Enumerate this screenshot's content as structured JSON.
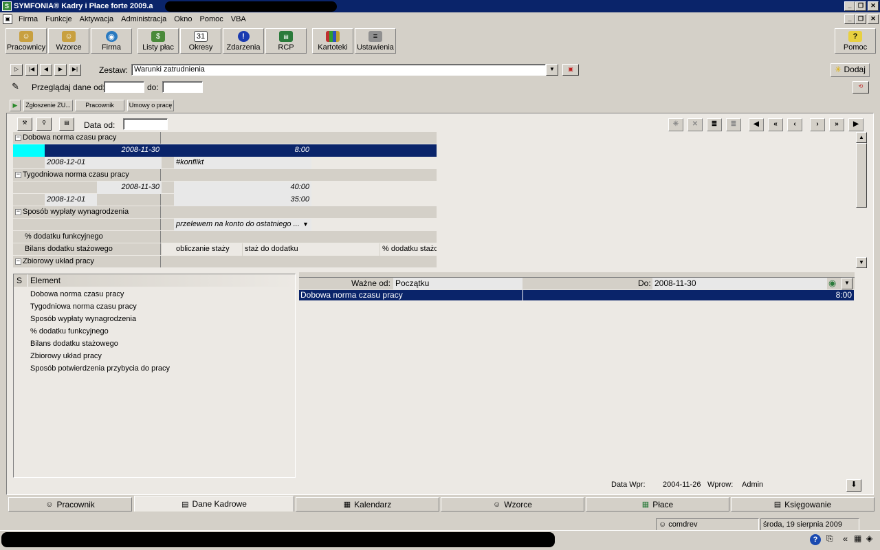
{
  "window": {
    "title": "SYMFONIA® Kadry i Płace forte 2009.a"
  },
  "menu": [
    "Firma",
    "Funkcje",
    "Aktywacja",
    "Administracja",
    "Okno",
    "Pomoc",
    "VBA"
  ],
  "toolbar": {
    "buttons": [
      {
        "label": "Pracownicy",
        "icon": "people-icon"
      },
      {
        "label": "Wzorce",
        "icon": "templates-icon"
      },
      {
        "label": "Firma",
        "icon": "globe-icon"
      },
      {
        "label": "Listy płac",
        "icon": "money-icon"
      },
      {
        "label": "Okresy",
        "icon": "calendar-icon"
      },
      {
        "label": "Zdarzenia",
        "icon": "exclamation-icon"
      },
      {
        "label": "RCP",
        "icon": "rcp-icon"
      },
      {
        "label": "Kartoteki",
        "icon": "binders-icon"
      },
      {
        "label": "Ustawienia",
        "icon": "sliders-icon"
      }
    ],
    "help": "Pomoc"
  },
  "filter": {
    "zestaw_label": "Zestaw:",
    "zestaw_value": "Warunki zatrudnienia",
    "add_label": "Dodaj",
    "browse_label": "Przeglądaj dane od:",
    "to_label": "do:",
    "from_value": "",
    "to_value": ""
  },
  "subtabs": [
    "Zgłoszenie ZU...",
    "Pracownik",
    "Umowy o pracę"
  ],
  "grid": {
    "date_label": "Data od:",
    "date_value": "",
    "rows": [
      {
        "type": "group",
        "label": "Dobowa norma czasu pracy"
      },
      {
        "type": "child",
        "date": "2008-11-30",
        "value": "8:00",
        "selected": true
      },
      {
        "type": "child2",
        "date": "2008-12-01",
        "value": "#konflikt"
      },
      {
        "type": "group",
        "label": "Tygodniowa norma czasu pracy"
      },
      {
        "type": "child",
        "date": "2008-11-30",
        "value": "40:00"
      },
      {
        "type": "child2",
        "date": "2008-12-01",
        "value": "35:00"
      },
      {
        "type": "group",
        "label": "Sposób wypłaty wynagrodzenia"
      },
      {
        "type": "combo",
        "value": "przelewem na konto do ostatniego ..."
      },
      {
        "type": "plain",
        "label": "% dodatku funkcyjnego"
      },
      {
        "type": "triple",
        "label": "Bilans dodatku stażowego",
        "c1": "obliczanie staży",
        "c2": "staż do dodatku",
        "c3": "% dodatku stażo..."
      },
      {
        "type": "group",
        "label": "Zbiorowy układ pracy"
      }
    ]
  },
  "elements": {
    "col_s": "S",
    "col_element": "Element",
    "items": [
      "Dobowa norma czasu pracy",
      "Tygodniowa norma czasu pracy",
      "Sposób wypłaty wynagrodzenia",
      "% dodatku funkcyjnego",
      "Bilans dodatku stażowego",
      "Zbiorowy układ pracy",
      "Sposób potwierdzenia przybycia do pracy"
    ]
  },
  "detail": {
    "valid_from_label": "Ważne od:",
    "valid_from_value": "Początku",
    "to_label": "Do:",
    "to_value": "2008-11-30",
    "row_name": "Dobowa norma czasu pracy",
    "row_value": "8:00",
    "entry_date_label": "Data Wpr:",
    "entry_date_value": "2004-11-26",
    "entered_by_label": "Wprow:",
    "entered_by_value": "Admin"
  },
  "bottom_tabs": [
    {
      "label": "Pracownik",
      "icon": "person-icon"
    },
    {
      "label": "Dane Kadrowe",
      "icon": "document-icon",
      "active": true
    },
    {
      "label": "Kalendarz",
      "icon": "calendar-icon"
    },
    {
      "label": "Wzorce",
      "icon": "templates-icon"
    },
    {
      "label": "Płace",
      "icon": "calculator-icon"
    },
    {
      "label": "Księgowanie",
      "icon": "ledger-icon"
    }
  ],
  "status": {
    "user": "comdrev",
    "date": "środa, 19 sierpnia 2009"
  }
}
